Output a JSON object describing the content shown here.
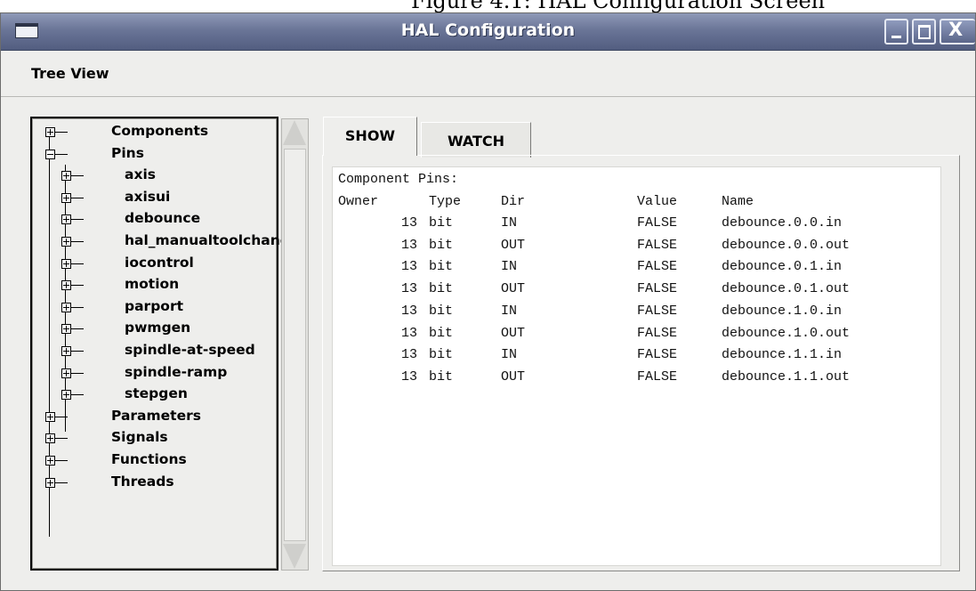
{
  "page_caption": "Figure 4.1: HAL Configuration Screen",
  "window": {
    "title": "HAL Configuration",
    "controls": {
      "minimize": "minimize",
      "maximize": "maximize",
      "close": "X"
    }
  },
  "menubar": {
    "items": [
      "Tree View"
    ]
  },
  "tree": {
    "items": [
      {
        "label": "Components",
        "expanded": false,
        "level": 0
      },
      {
        "label": "Pins",
        "expanded": true,
        "level": 0
      },
      {
        "label": "axis",
        "expanded": false,
        "level": 1
      },
      {
        "label": "axisui",
        "expanded": false,
        "level": 1
      },
      {
        "label": "debounce",
        "expanded": false,
        "level": 1
      },
      {
        "label": "hal_manualtoolchange",
        "expanded": false,
        "level": 1
      },
      {
        "label": "iocontrol",
        "expanded": false,
        "level": 1
      },
      {
        "label": "motion",
        "expanded": false,
        "level": 1
      },
      {
        "label": "parport",
        "expanded": false,
        "level": 1
      },
      {
        "label": "pwmgen",
        "expanded": false,
        "level": 1
      },
      {
        "label": "spindle-at-speed",
        "expanded": false,
        "level": 1
      },
      {
        "label": "spindle-ramp",
        "expanded": false,
        "level": 1
      },
      {
        "label": "stepgen",
        "expanded": false,
        "level": 1
      },
      {
        "label": "Parameters",
        "expanded": false,
        "level": 0
      },
      {
        "label": "Signals",
        "expanded": false,
        "level": 0
      },
      {
        "label": "Functions",
        "expanded": false,
        "level": 0
      },
      {
        "label": "Threads",
        "expanded": false,
        "level": 0
      }
    ]
  },
  "tabs": [
    {
      "label": "SHOW",
      "active": true
    },
    {
      "label": "WATCH",
      "active": false
    }
  ],
  "output": {
    "heading": "Component Pins:",
    "columns": [
      "Owner",
      "Type",
      "Dir",
      "Value",
      "Name"
    ],
    "rows": [
      [
        "13",
        "bit",
        "IN",
        "FALSE",
        "debounce.0.0.in"
      ],
      [
        "13",
        "bit",
        "OUT",
        "FALSE",
        "debounce.0.0.out"
      ],
      [
        "13",
        "bit",
        "IN",
        "FALSE",
        "debounce.0.1.in"
      ],
      [
        "13",
        "bit",
        "OUT",
        "FALSE",
        "debounce.0.1.out"
      ],
      [
        "13",
        "bit",
        "IN",
        "FALSE",
        "debounce.1.0.in"
      ],
      [
        "13",
        "bit",
        "OUT",
        "FALSE",
        "debounce.1.0.out"
      ],
      [
        "13",
        "bit",
        "IN",
        "FALSE",
        "debounce.1.1.in"
      ],
      [
        "13",
        "bit",
        "OUT",
        "FALSE",
        "debounce.1.1.out"
      ]
    ]
  },
  "colors": {
    "titlebar": "#6a7597",
    "window_bg": "#eeeeec",
    "output_bg": "#ffffff"
  }
}
